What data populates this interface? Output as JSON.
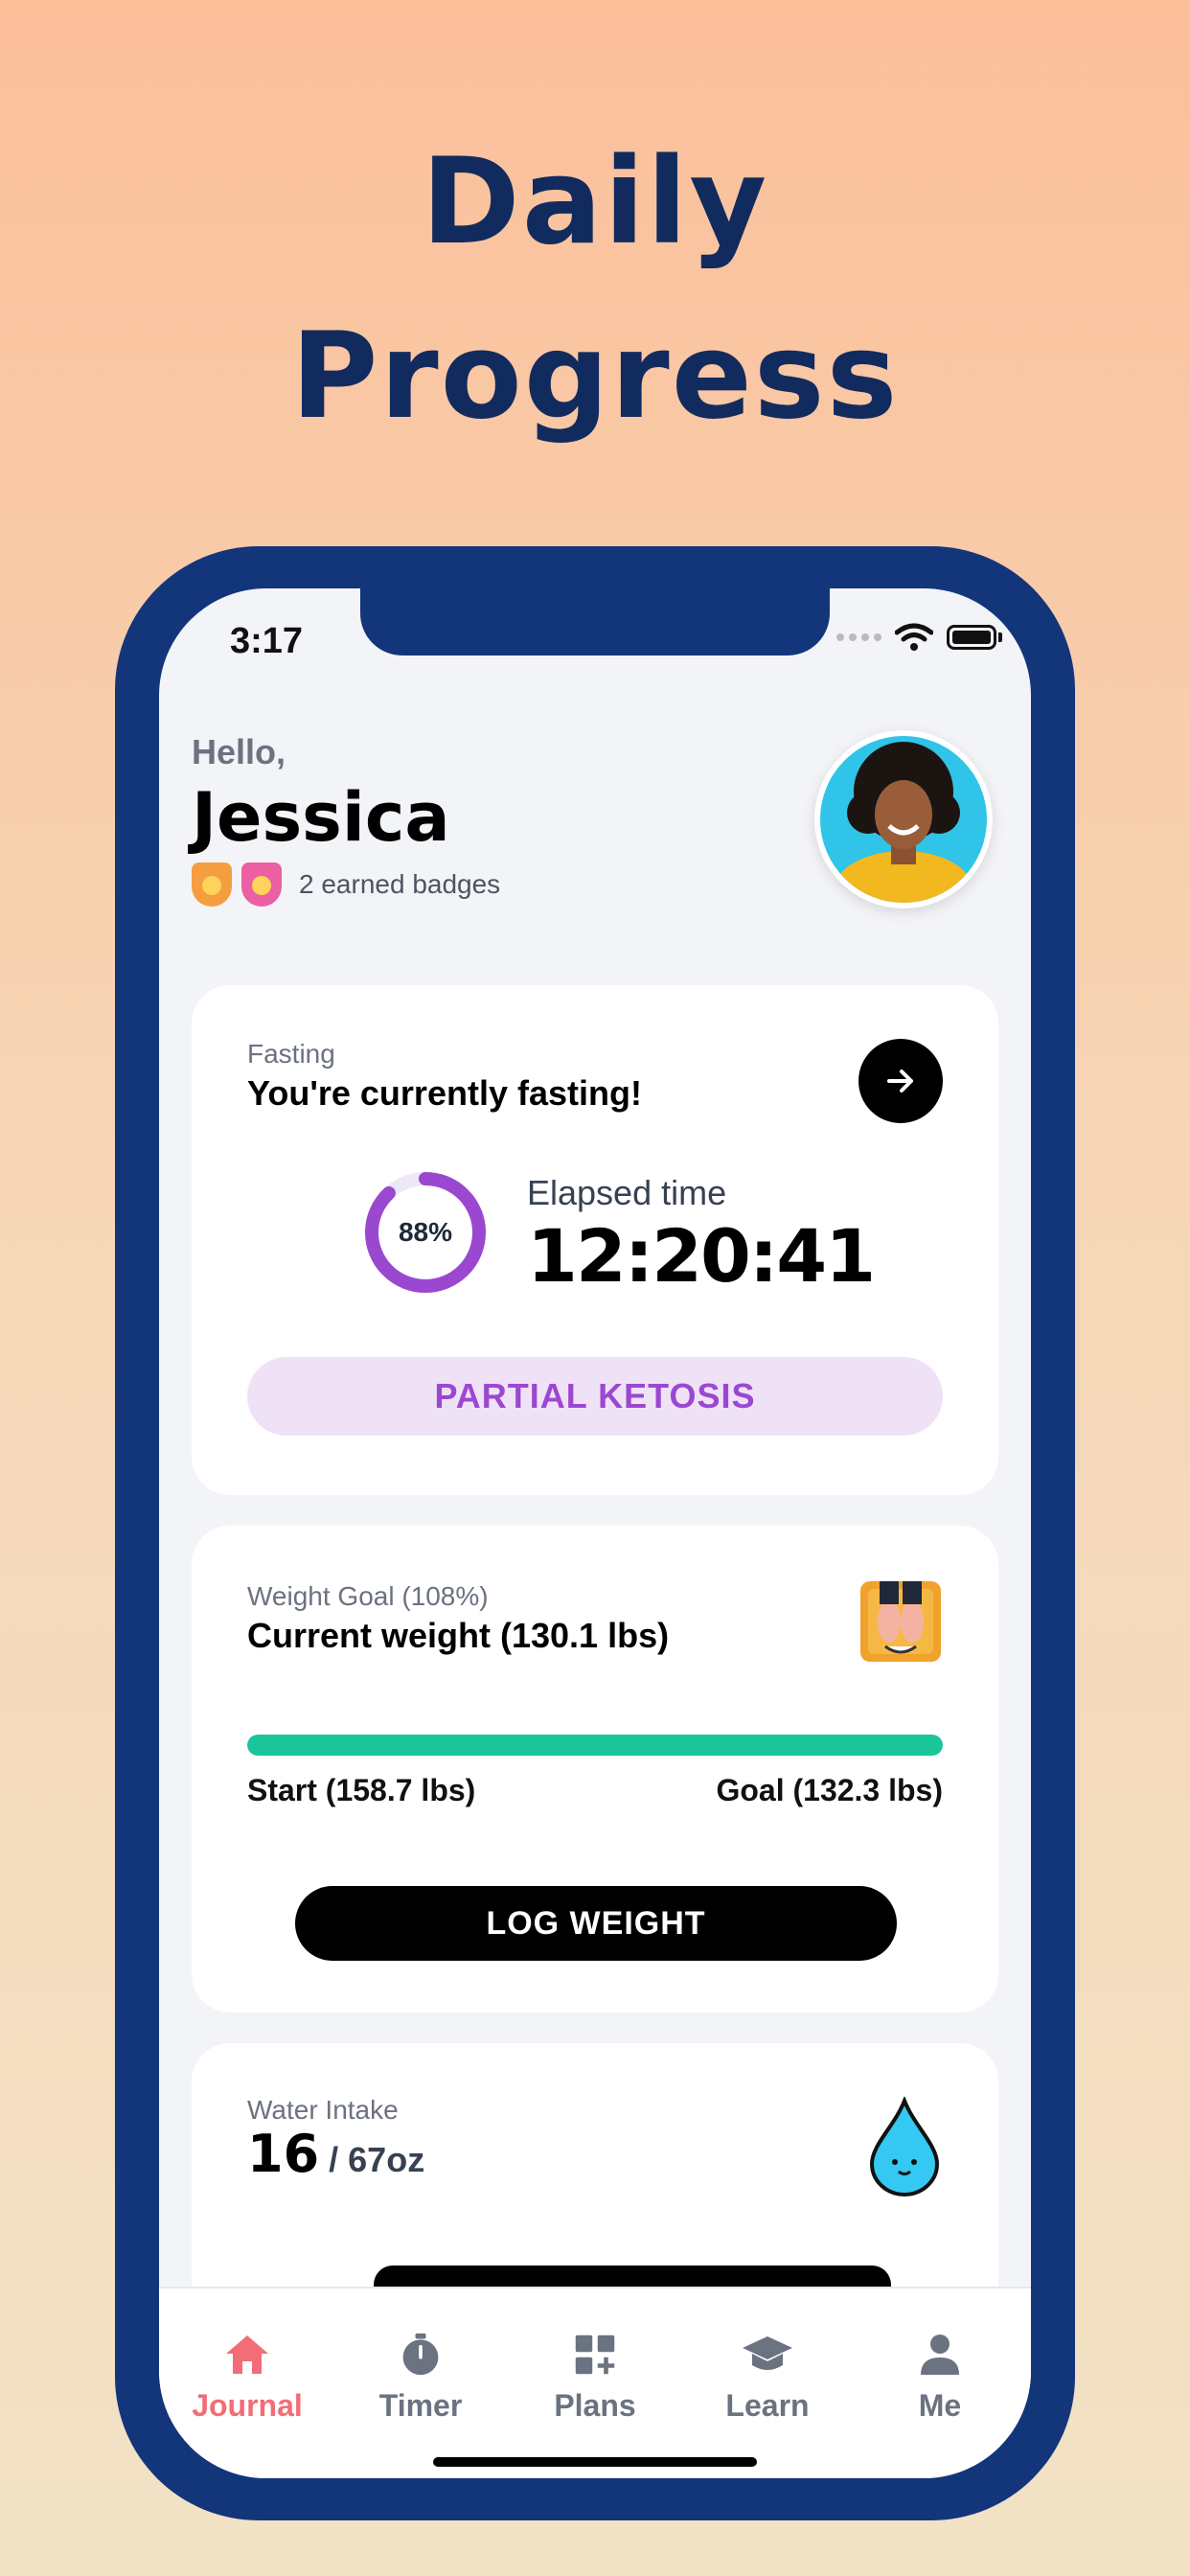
{
  "headline": {
    "line1": "Daily",
    "line2": "Progress"
  },
  "status": {
    "time": "3:17"
  },
  "greeting": {
    "hello": "Hello,",
    "name": "Jessica",
    "badges_text": "2 earned badges"
  },
  "fasting": {
    "label": "Fasting",
    "title": "You're currently fasting!",
    "progress_percent": 88,
    "progress_text": "88%",
    "elapsed_label": "Elapsed time",
    "elapsed_value": "12:20:41",
    "stage": "PARTIAL KETOSIS"
  },
  "weight": {
    "label": "Weight Goal (108%)",
    "title": "Current weight (130.1 lbs)",
    "progress_percent": 100,
    "start": "Start (158.7 lbs)",
    "goal": "Goal (132.3 lbs)",
    "button": "LOG WEIGHT"
  },
  "water": {
    "label": "Water Intake",
    "current": "16",
    "goal": " / 67oz"
  },
  "tabs": [
    {
      "label": "Journal",
      "icon": "home-icon",
      "active": true
    },
    {
      "label": "Timer",
      "icon": "stopwatch-icon",
      "active": false
    },
    {
      "label": "Plans",
      "icon": "grid-plus-icon",
      "active": false
    },
    {
      "label": "Learn",
      "icon": "graduation-cap-icon",
      "active": false
    },
    {
      "label": "Me",
      "icon": "person-icon",
      "active": false
    }
  ],
  "colors": {
    "accent_navy": "#13357a",
    "ketosis_purple": "#9b48d1",
    "progress_green": "#1bc59a",
    "active_tab": "#f26d76"
  }
}
